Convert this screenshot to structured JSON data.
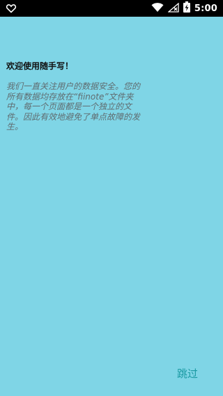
{
  "status_bar": {
    "time": "5:00",
    "icons": [
      "heart-outline-icon",
      "wifi-icon",
      "signal-no-sim-icon",
      "battery-charging-icon"
    ]
  },
  "welcome": {
    "title": "欢迎使用随手写！",
    "body": "我们一直关注用户的数据安全。您的所有数据均存放在“fiinote”文件夹中，每一个页面都是一个独立的文件。因此有效地避免了单点故障的发生。"
  },
  "actions": {
    "skip_label": "跳过"
  },
  "colors": {
    "background": "#7fd5e6",
    "accent": "#1a9aa3",
    "status_bar": "#000000"
  }
}
